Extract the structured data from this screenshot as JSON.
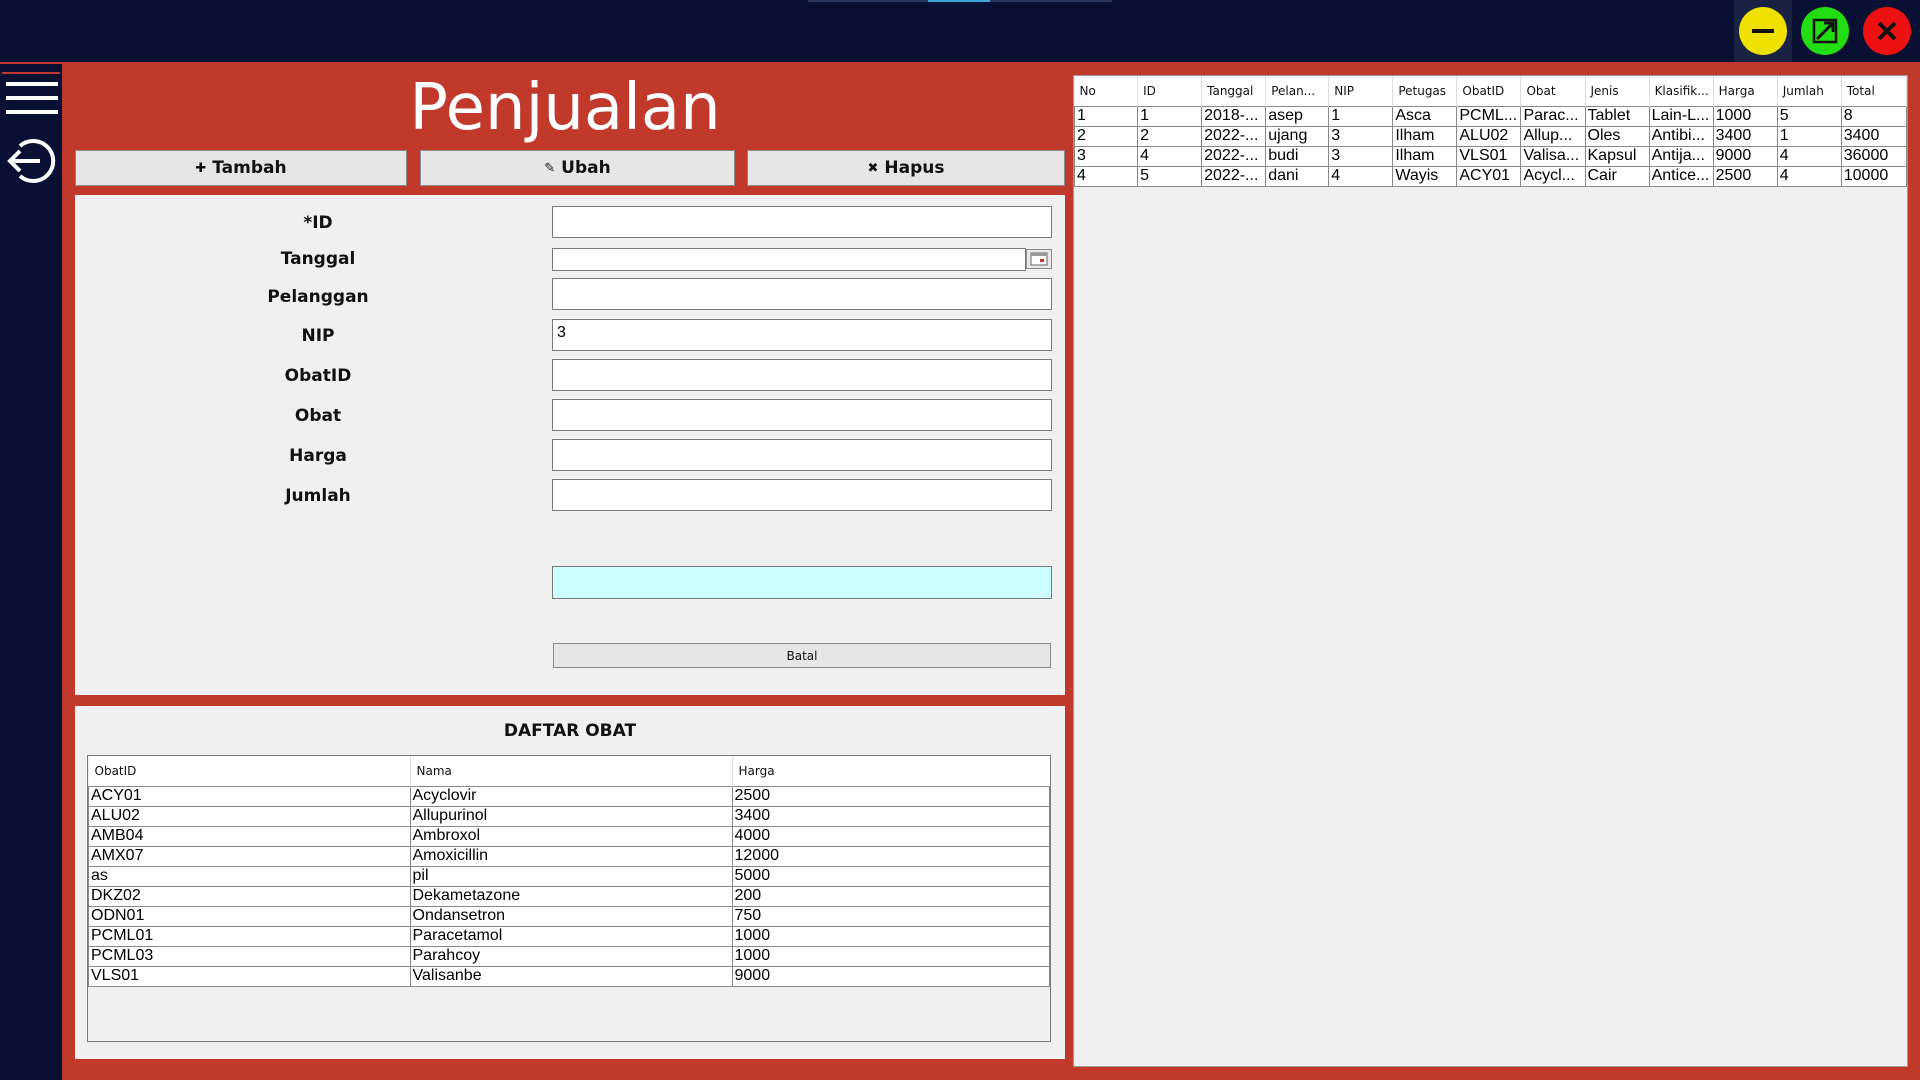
{
  "window": {
    "minimize_icon": "minus-icon",
    "maximize_icon": "maximize-icon",
    "close_icon": "close-icon"
  },
  "sidebar": {
    "menu_icon": "hamburger-icon",
    "logout_icon": "logout-icon"
  },
  "page": {
    "title": "Penjualan"
  },
  "toolbar": {
    "add_label": "Tambah",
    "edit_label": "Ubah",
    "delete_label": "Hapus"
  },
  "form": {
    "fields": [
      {
        "label": "*ID",
        "value": ""
      },
      {
        "label": "Tanggal",
        "value": ""
      },
      {
        "label": "Pelanggan",
        "value": ""
      },
      {
        "label": "NIP",
        "value": "3"
      },
      {
        "label": "ObatID",
        "value": ""
      },
      {
        "label": "Obat",
        "value": ""
      },
      {
        "label": "Harga",
        "value": ""
      },
      {
        "label": "Jumlah",
        "value": ""
      }
    ],
    "extra_value": "",
    "cancel_label": "Batal"
  },
  "obat_list": {
    "title": "DAFTAR OBAT",
    "columns": [
      "ObatID",
      "Nama",
      "Harga"
    ],
    "rows": [
      [
        "ACY01",
        "Acyclovir",
        "2500"
      ],
      [
        "ALU02",
        "Allupurinol",
        "3400"
      ],
      [
        "AMB04",
        "Ambroxol",
        "4000"
      ],
      [
        "AMX07",
        "Amoxicillin",
        "12000"
      ],
      [
        "as",
        "pil",
        "5000"
      ],
      [
        "DKZ02",
        "Dekametazone",
        "200"
      ],
      [
        "ODN01",
        "Ondansetron",
        "750"
      ],
      [
        "PCML01",
        "Paracetamol",
        "1000"
      ],
      [
        "PCML03",
        "Parahcoy",
        "1000"
      ],
      [
        "VLS01",
        "Valisanbe",
        "9000"
      ]
    ]
  },
  "sales_table": {
    "columns": [
      "No",
      "ID",
      "Tanggal",
      "Pelan...",
      "NIP",
      "Petugas",
      "ObatID",
      "Obat",
      "Jenis",
      "Klasifik...",
      "Harga",
      "Jumlah",
      "Total"
    ],
    "rows": [
      [
        "1",
        "1",
        "2018-...",
        "asep",
        "1",
        "Asca",
        "PCML...",
        "Parac...",
        "Tablet",
        "Lain-L...",
        "1000",
        "5",
        "8"
      ],
      [
        "2",
        "2",
        "2022-...",
        "ujang",
        "3",
        "Ilham",
        "ALU02",
        "Allup...",
        "Oles",
        "Antibi...",
        "3400",
        "1",
        "3400"
      ],
      [
        "3",
        "4",
        "2022-...",
        "budi",
        "3",
        "Ilham",
        "VLS01",
        "Valisa...",
        "Kapsul",
        "Antija...",
        "9000",
        "4",
        "36000"
      ],
      [
        "4",
        "5",
        "2022-...",
        "dani",
        "4",
        "Wayis",
        "ACY01",
        "Acycl...",
        "Cair",
        "Antice...",
        "2500",
        "4",
        "10000"
      ]
    ]
  },
  "colors": {
    "background": "#0a1033",
    "accent": "#c0392b",
    "minimize": "#f0e000",
    "maximize": "#22dd11",
    "close": "#ee1111",
    "highlight_input": "#ccffff"
  }
}
